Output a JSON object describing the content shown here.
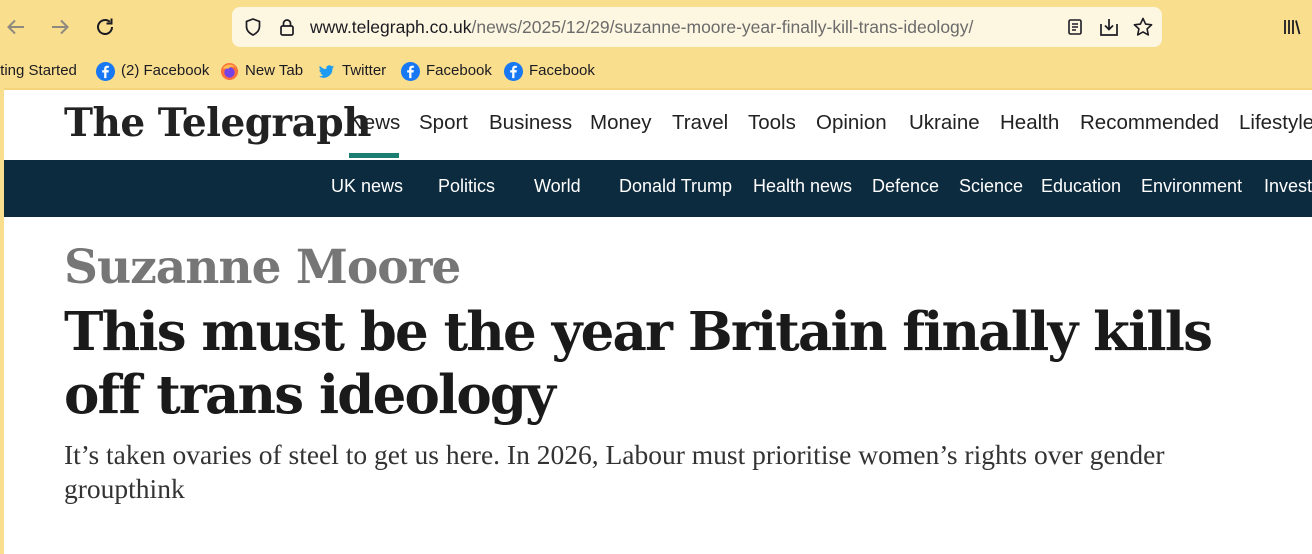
{
  "browser": {
    "url_domain": "www.telegraph.co.uk",
    "url_path": "/news/2025/12/29/suzanne-moore-year-finally-kill-trans-ideology/",
    "bookmarks": [
      {
        "label": "tting Started",
        "icon": "partial-icon"
      },
      {
        "label": "(2) Facebook",
        "icon": "facebook-icon"
      },
      {
        "label": "New Tab",
        "icon": "firefox-icon"
      },
      {
        "label": "Twitter",
        "icon": "twitter-icon"
      },
      {
        "label": "Facebook",
        "icon": "facebook-icon"
      },
      {
        "label": "Facebook",
        "icon": "facebook-icon"
      }
    ],
    "colors": {
      "chrome": "#f9de8e",
      "urlbar": "#fdf6e1"
    }
  },
  "site": {
    "logo": "The Telegraph",
    "main_nav": [
      "News",
      "Sport",
      "Business",
      "Money",
      "Travel",
      "Tools",
      "Opinion",
      "Ukraine",
      "Health",
      "Recommended",
      "Lifestyle"
    ],
    "active_main_nav": "News",
    "sub_nav": [
      "UK news",
      "Politics",
      "World",
      "Donald Trump",
      "Health news",
      "Defence",
      "Science",
      "Education",
      "Environment",
      "Investigations"
    ],
    "colors": {
      "subnav_bg": "#0d2b3e",
      "accent": "#1c7e73"
    }
  },
  "article": {
    "author": "Suzanne Moore",
    "headline": "This must be the year Britain finally kills off trans ideology",
    "standfirst": "It’s taken ovaries of steel to get us here. In 2026, Labour must prioritise women’s rights over gender groupthink"
  }
}
